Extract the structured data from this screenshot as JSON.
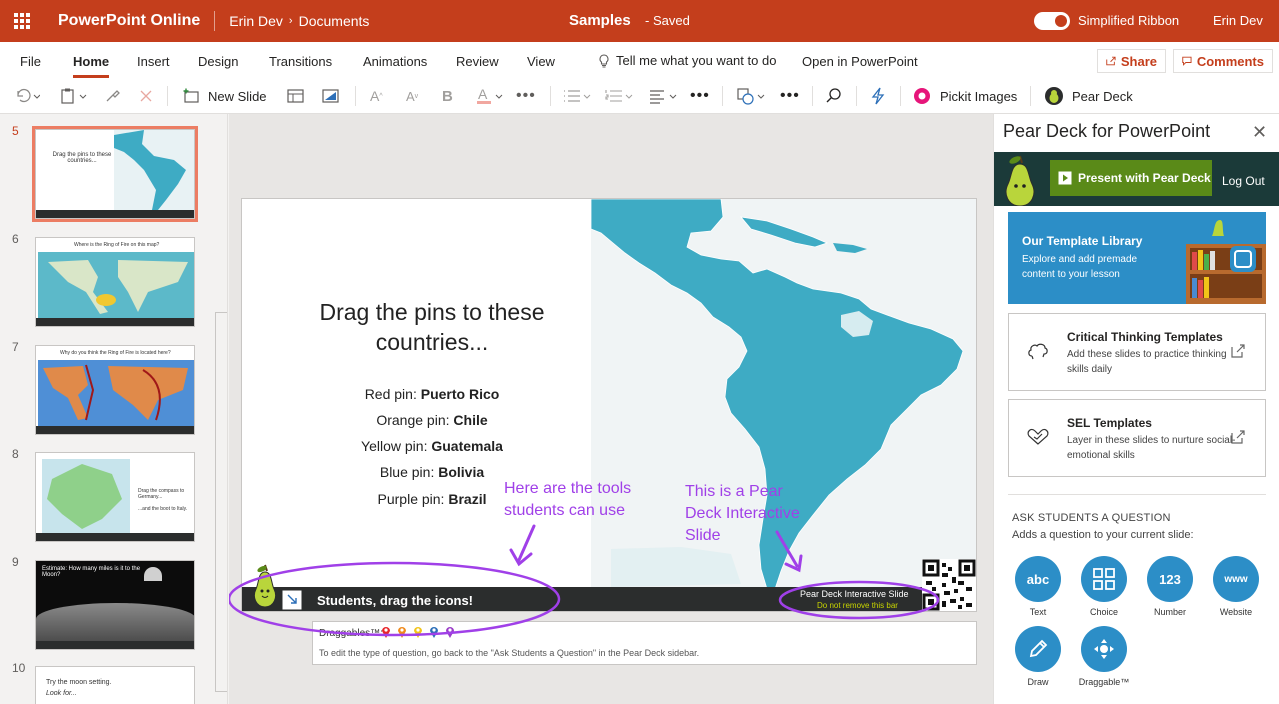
{
  "topbar": {
    "app_name": "PowerPoint Online",
    "user_link": "Erin Dev",
    "folder": "Documents",
    "doc_title": "Samples",
    "doc_status": "-   Saved",
    "ribbon_label": "Simplified Ribbon",
    "user_name": "Erin Dev"
  },
  "tabs": [
    "File",
    "Home",
    "Insert",
    "Design",
    "Transitions",
    "Animations",
    "Review",
    "View"
  ],
  "tell_me": "Tell me what you want to do",
  "open_in": "Open in PowerPoint",
  "share_label": "Share",
  "comments_label": "Comments",
  "toolbar": {
    "new_slide": "New Slide",
    "pickit": "Pickit Images",
    "peardeck": "Pear Deck"
  },
  "slides": [
    {
      "num": "5",
      "title": "Drag the pins to these countries..."
    },
    {
      "num": "6",
      "title": "Where is the Ring of Fire on this map?"
    },
    {
      "num": "7",
      "title": "Why do you think the Ring of Fire is located here?"
    },
    {
      "num": "8",
      "title": "Drag the compass to Germany..."
    },
    {
      "num": "9",
      "title": "Estimate: How many miles is it to the Moon?"
    },
    {
      "num": "10",
      "title": "Try the moon setting.",
      "sub": "Look for..."
    }
  ],
  "thumb8_sub": "...and the boot to Italy.",
  "slide": {
    "title_line1": "Drag the pins to these",
    "title_line2": "countries...",
    "pins": [
      {
        "label": "Red pin: ",
        "country": "Puerto Rico"
      },
      {
        "label": "Orange pin: ",
        "country": "Chile"
      },
      {
        "label": "Yellow pin: ",
        "country": "Guatemala"
      },
      {
        "label": "Blue pin: ",
        "country": "Bolivia"
      },
      {
        "label": "Purple pin: ",
        "country": "Brazil"
      }
    ],
    "bar_label": "Students, drag the icons!",
    "bar_right_1": "Pear Deck Interactive Slide",
    "bar_right_2": "Do not remove this bar"
  },
  "draggables": {
    "label": "Draggables™:",
    "hint": "To edit the type of question, go back to the \"Ask Students a Question\" in the Pear Deck sidebar.",
    "pin_colors": [
      "#e8262b",
      "#f08a1c",
      "#f2c418",
      "#2c6fb8",
      "#9a3cc8"
    ]
  },
  "annotations": {
    "tools_line1": "Here are the tools",
    "tools_line2": "students can use",
    "pear_line1": "This is a Pear",
    "pear_line2": "Deck Interactive",
    "pear_line3": "Slide"
  },
  "sidebar": {
    "title": "Pear Deck for PowerPoint",
    "present_btn": "Present with Pear Deck",
    "logout": "Log Out",
    "library_title": "Our Template Library",
    "library_desc": "Explore and add premade content to your lesson",
    "templates": [
      {
        "title": "Critical Thinking Templates",
        "desc": "Add these slides to practice thinking skills daily"
      },
      {
        "title": "SEL Templates",
        "desc": "Layer in these slides to nurture social-emotional skills"
      }
    ],
    "ask_heading": "ASK STUDENTS A QUESTION",
    "ask_sub": "Adds a question to your current slide:",
    "questions": [
      {
        "icon_text": "abc",
        "label": "Text"
      },
      {
        "icon_text": "",
        "label": "Choice"
      },
      {
        "icon_text": "123",
        "label": "Number"
      },
      {
        "icon_text": "www",
        "label": "Website"
      },
      {
        "icon_text": "",
        "label": "Draw"
      },
      {
        "icon_text": "",
        "label": "Draggable™"
      }
    ]
  },
  "colors": {
    "brand": "#c43e1c",
    "accent": "#2c8ec7",
    "annotation": "#a040e8"
  }
}
